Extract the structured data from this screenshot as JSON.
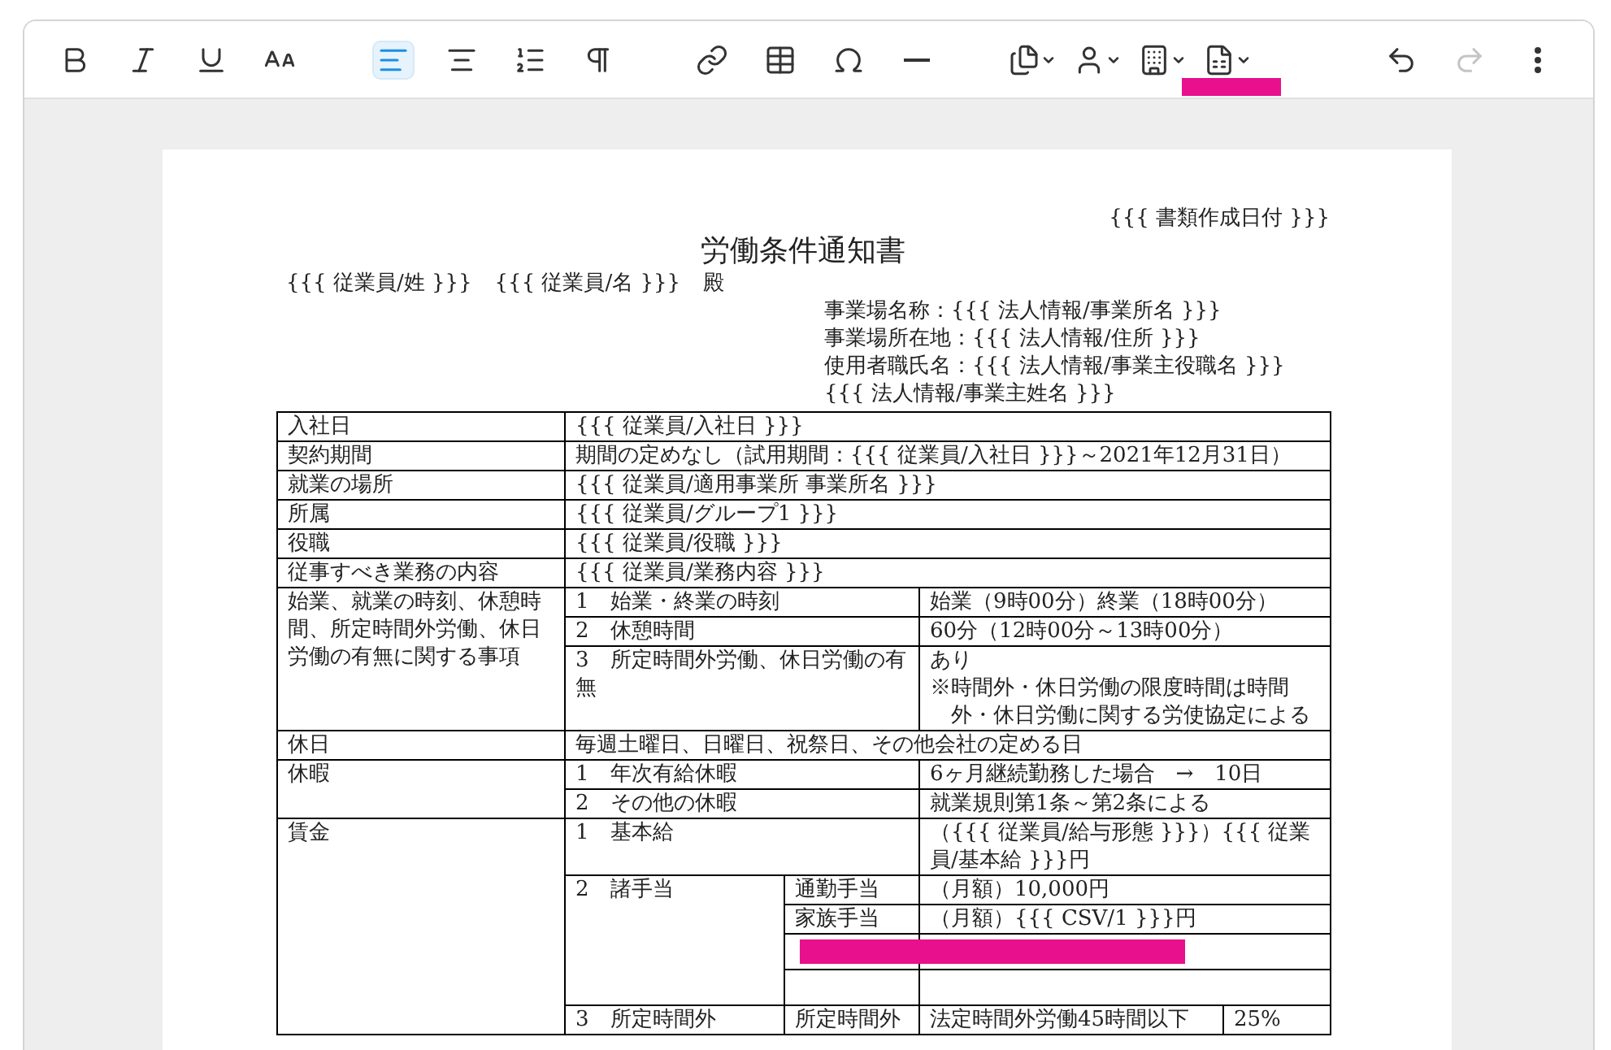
{
  "toolbar": [
    [
      {
        "kind": "bold",
        "selected": false,
        "disabled": false,
        "menu": false
      },
      {
        "kind": "italic",
        "selected": false,
        "disabled": false,
        "menu": false
      },
      {
        "kind": "underline",
        "selected": false,
        "disabled": false,
        "menu": false
      },
      {
        "kind": "font-size",
        "selected": false,
        "disabled": false,
        "menu": false
      }
    ],
    [
      {
        "kind": "align-left",
        "selected": true,
        "disabled": false,
        "menu": false
      },
      {
        "kind": "align-center",
        "selected": false,
        "disabled": false,
        "menu": false
      },
      {
        "kind": "numbered-list",
        "selected": false,
        "disabled": false,
        "menu": false
      },
      {
        "kind": "paragraph",
        "selected": false,
        "disabled": false,
        "menu": false
      }
    ],
    [
      {
        "kind": "link",
        "selected": false,
        "disabled": false,
        "menu": false
      },
      {
        "kind": "table",
        "selected": false,
        "disabled": false,
        "menu": false
      },
      {
        "kind": "omega",
        "selected": false,
        "disabled": false,
        "menu": false
      },
      {
        "kind": "horizontal-line",
        "selected": false,
        "disabled": false,
        "menu": false
      }
    ],
    [
      {
        "kind": "document",
        "selected": false,
        "disabled": false,
        "menu": true
      },
      {
        "kind": "person",
        "selected": false,
        "disabled": false,
        "menu": true
      },
      {
        "kind": "building",
        "selected": false,
        "disabled": false,
        "menu": true
      },
      {
        "kind": "spreadsheet",
        "selected": false,
        "disabled": false,
        "menu": true
      }
    ],
    [
      {
        "kind": "undo",
        "selected": false,
        "disabled": false,
        "menu": false
      },
      {
        "kind": "redo",
        "selected": false,
        "disabled": true,
        "menu": false
      },
      {
        "kind": "more",
        "selected": false,
        "disabled": false,
        "menu": false
      }
    ]
  ],
  "document": {
    "date": "{{{ 書類作成日付 }}}",
    "title": "労働条件通知書",
    "recipient": [
      "{{{ 従業員/姓 }}}",
      "{{{ 従業員/名 }}}",
      "殿"
    ],
    "employer_lines": [
      "事業場名称：{{{ 法人情報/事業所名 }}}",
      "事業場所在地：{{{ 法人情報/住所  }}}",
      "使用者職氏名：{{{ 法人情報/事業主役職名 }}} {{{ 法人情報/事業主姓名 }}}"
    ],
    "table": {
      "rows": [
        [
          {
            "text": "入社日"
          },
          {
            "text": "{{{ 従業員/入社日 }}}",
            "colspan": 4
          }
        ],
        [
          {
            "text": "契約期間"
          },
          {
            "text": "期間の定めなし（試用期間：{{{ 従業員/入社日 }}}～2021年12月31日）",
            "colspan": 4
          }
        ],
        [
          {
            "text": "就業の場所"
          },
          {
            "text": "{{{ 従業員/適用事業所 事業所名 }}}",
            "colspan": 4
          }
        ],
        [
          {
            "text": "所属"
          },
          {
            "text": "{{{ 従業員/グループ1 }}}",
            "colspan": 4
          }
        ],
        [
          {
            "text": "役職"
          },
          {
            "text": "{{{ 従業員/役職 }}}",
            "colspan": 4
          }
        ],
        [
          {
            "text": "従事すべき業務の内容"
          },
          {
            "text": "{{{ 従業員/業務内容 }}}",
            "colspan": 4
          }
        ],
        [
          {
            "text": "始業、就業の時刻、休憩時間、所定時間外労働、休日労働の有無に関する事項",
            "rowspan": 3
          },
          {
            "text": "1　始業・終業の時刻",
            "colspan": 2
          },
          {
            "text": "始業（9時00分）終業（18時00分）",
            "colspan": 2
          }
        ],
        [
          {
            "text": "2　休憩時間",
            "colspan": 2
          },
          {
            "text": "60分（12時00分～13時00分）",
            "colspan": 2
          }
        ],
        [
          {
            "text": "3　所定時間外労働、休日労働の有無",
            "colspan": 2
          },
          {
            "lines": [
              "あり",
              "※時間外・休日労働の限度時間は時間外・休日労働に関する労使協定による"
            ],
            "colspan": 2
          }
        ],
        [
          {
            "text": "休日"
          },
          {
            "text": "毎週土曜日、日曜日、祝祭日、その他会社の定める日",
            "colspan": 4
          }
        ],
        [
          {
            "text": "休暇",
            "rowspan": 2
          },
          {
            "text": "1　年次有給休暇",
            "colspan": 2
          },
          {
            "text": "6ヶ月継続勤務した場合　→　10日",
            "colspan": 2
          }
        ],
        [
          {
            "text": "2　その他の休暇",
            "colspan": 2
          },
          {
            "text": "就業規則第1条～第2条による",
            "colspan": 2
          }
        ],
        [
          {
            "text": "賃金",
            "rowspan": 6
          },
          {
            "text": "1　基本給",
            "colspan": 2
          },
          {
            "text": "（{{{ 従業員/給与形態 }}}）{{{ 従業員/基本給 }}}円",
            "colspan": 2
          }
        ],
        [
          {
            "text": "2　諸手当",
            "rowspan": 4
          },
          {
            "text": "通勤手当"
          },
          {
            "text": "（月額）10,000円",
            "colspan": 2
          }
        ],
        [
          {
            "text": "家族手当"
          },
          {
            "text": "（月額）{{{ CSV/1 }}}円",
            "colspan": 2
          }
        ],
        [
          {},
          {
            "colspan": 2
          }
        ],
        [
          {},
          {
            "colspan": 2
          }
        ],
        [
          {
            "text": "3　所定時間外"
          },
          {
            "text": "所定時間外"
          },
          {
            "text": "法定時間外労働45時間以下"
          },
          {
            "text": "25%"
          }
        ]
      ]
    }
  }
}
